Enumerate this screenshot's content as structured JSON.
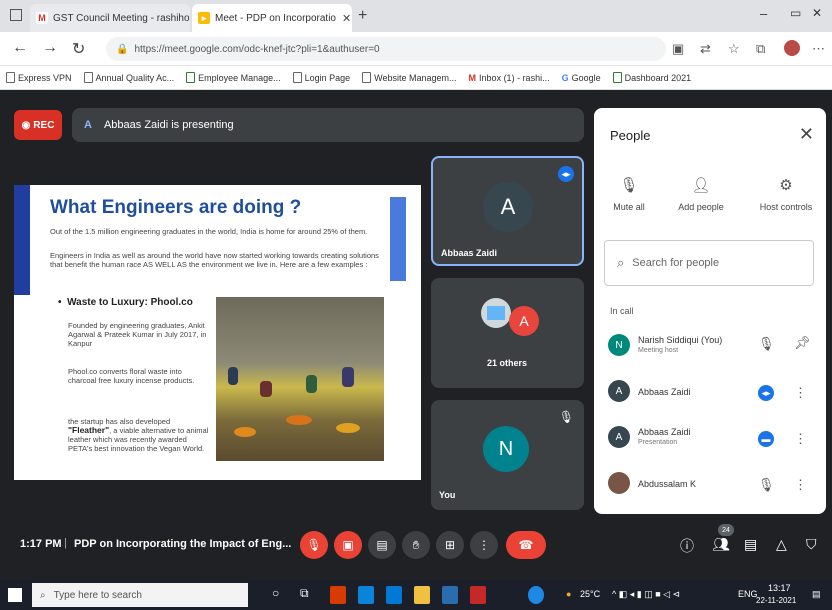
{
  "browser": {
    "tabs": [
      {
        "label": "GST Council Meeting - rashiho",
        "icon": "gmail-icon"
      },
      {
        "label": "Meet - PDP on Incorporatio",
        "icon": "meet-icon"
      }
    ],
    "new_tab": "+",
    "url": "https://meet.google.com/odc-knef-jtc?pli=1&authuser=0",
    "bookmarks": [
      "Express VPN",
      "Annual Quality Ac...",
      "Employee Manage...",
      "Login Page",
      "Website Managem...",
      "Inbox (1) - rashi...",
      "Google",
      "Dashboard 2021"
    ]
  },
  "meet": {
    "rec_label": "REC",
    "presenting_text": "Abbaas Zaidi is presenting",
    "presenting_initial": "A",
    "slide": {
      "title": "What Engineers are doing ?",
      "para1": "Out of the 1.5 million engineering graduates in the world, India is home for around 25% of them.",
      "para2": "Engineers in India as well as around the world have now started working towards creating solutions that benefit the human race AS WELL AS the environment we live in. Here are a few examples :",
      "bullet": "Waste to Luxury: Phool.co",
      "text1": "Founded by engineering graduates, Ankit Agarwal & Prateek Kumar in July 2017, in Kanpur",
      "text2": "Phool.co converts floral waste into charcoal free luxury incense products.",
      "text3_prefix": "the startup has also developed",
      "text3_bold": "\"Fleather\"",
      "text3_suffix": ", a viable alternative to animal leather which was recently awarded PETA's best innovation the Vegan World."
    },
    "tiles": [
      {
        "initial": "A",
        "name": "Abbaas Zaidi",
        "color": "#37474f"
      },
      {
        "initial": "A",
        "name": "21 others",
        "color": "#e8453c"
      },
      {
        "initial": "N",
        "name": "You",
        "color": "#00838f"
      }
    ],
    "time": "1:17 PM",
    "separator": "|",
    "meeting_name": "PDP on Incorporating the Impact of Eng...",
    "people_count": "24"
  },
  "people": {
    "title": "People",
    "actions": [
      "Mute all",
      "Add people",
      "Host controls"
    ],
    "search_placeholder": "Search for people",
    "section": "In call",
    "list": [
      {
        "initial": "N",
        "name": "Narish Siddiqui (You)",
        "sub": "Meeting host",
        "color": "#00897b"
      },
      {
        "initial": "A",
        "name": "Abbaas Zaidi",
        "sub": "",
        "color": "#37474f"
      },
      {
        "initial": "A",
        "name": "Abbaas Zaidi",
        "sub": "Presentation",
        "color": "#37474f"
      },
      {
        "initial": "",
        "name": "Abdussalam K",
        "sub": "",
        "color": "#795548"
      }
    ]
  },
  "taskbar": {
    "search_placeholder": "Type here to search",
    "weather": "25°C",
    "lang": "ENG",
    "time": "13:17",
    "date": "22-11-2021"
  }
}
